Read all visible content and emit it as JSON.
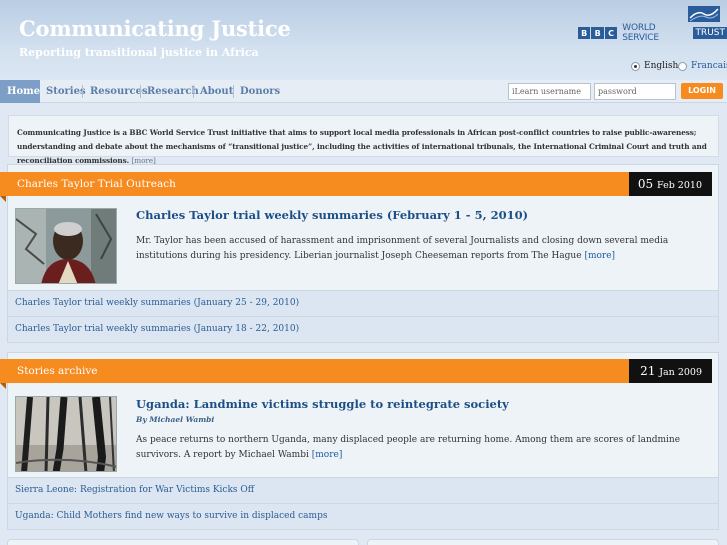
{
  "header": {
    "title": "Communicating Justice",
    "subtitle": "Reporting transitional justice in Africa",
    "logo": {
      "bbc": [
        "B",
        "B",
        "C"
      ],
      "text": "WORLD SERVICE",
      "trust": "TRUST"
    },
    "languages": [
      {
        "label": "English",
        "selected": true
      },
      {
        "label": "Francais",
        "selected": false
      }
    ]
  },
  "nav": {
    "items": [
      "Home",
      "Stories",
      "Resources",
      "Research",
      "About",
      "Donors"
    ],
    "active": "Home"
  },
  "login": {
    "username_placeholder": "iLearn username",
    "password_placeholder": "password",
    "button": "LOGIN"
  },
  "intro": {
    "text": "Communicating Justice is a BBC World Service Trust initiative that aims to support local media professionals in African post-conflict countries to raise public-awareness; understanding and debate about the mechanisms of “transitional justice”, including the activities of international tribunals, the International Criminal Court and truth and reconciliation commissions.",
    "more": "[more]"
  },
  "sections": [
    {
      "title": "Charles Taylor Trial Outreach",
      "date_day": "05",
      "date_rest": "Feb 2010",
      "headline": "Charles Taylor trial weekly summaries (February 1 - 5, 2010)",
      "byline": "",
      "summary": "Mr. Taylor has been accused of harassment and imprisonment of several Journalists and closing down several media institutions during his presidency. Liberian journalist Joseph Cheeseman reports from The Hague",
      "more": "[more]",
      "links": [
        "Charles Taylor trial weekly summaries (January 25 - 29, 2010)",
        "Charles Taylor trial weekly summaries (January 18 - 22, 2010)"
      ]
    },
    {
      "title": "Stories archive",
      "date_day": "21",
      "date_rest": "Jan 2009",
      "headline": "Uganda: Landmine victims struggle to reintegrate society",
      "byline": "By Michael Wambi",
      "summary": "As peace returns to northern Uganda, many displaced people are returning home. Among them are scores of landmine survivors. A report by Michael Wambi",
      "more": "[more]",
      "links": [
        "Sierra Leone: Registration for War Victims Kicks Off",
        "Uganda: Child Mothers find new ways to survive in displaced camps"
      ]
    }
  ],
  "colors": {
    "accent": "#f68b1f",
    "link": "#1d4f87",
    "nav_active": "#7d9fc7",
    "date_bg": "#111111"
  }
}
